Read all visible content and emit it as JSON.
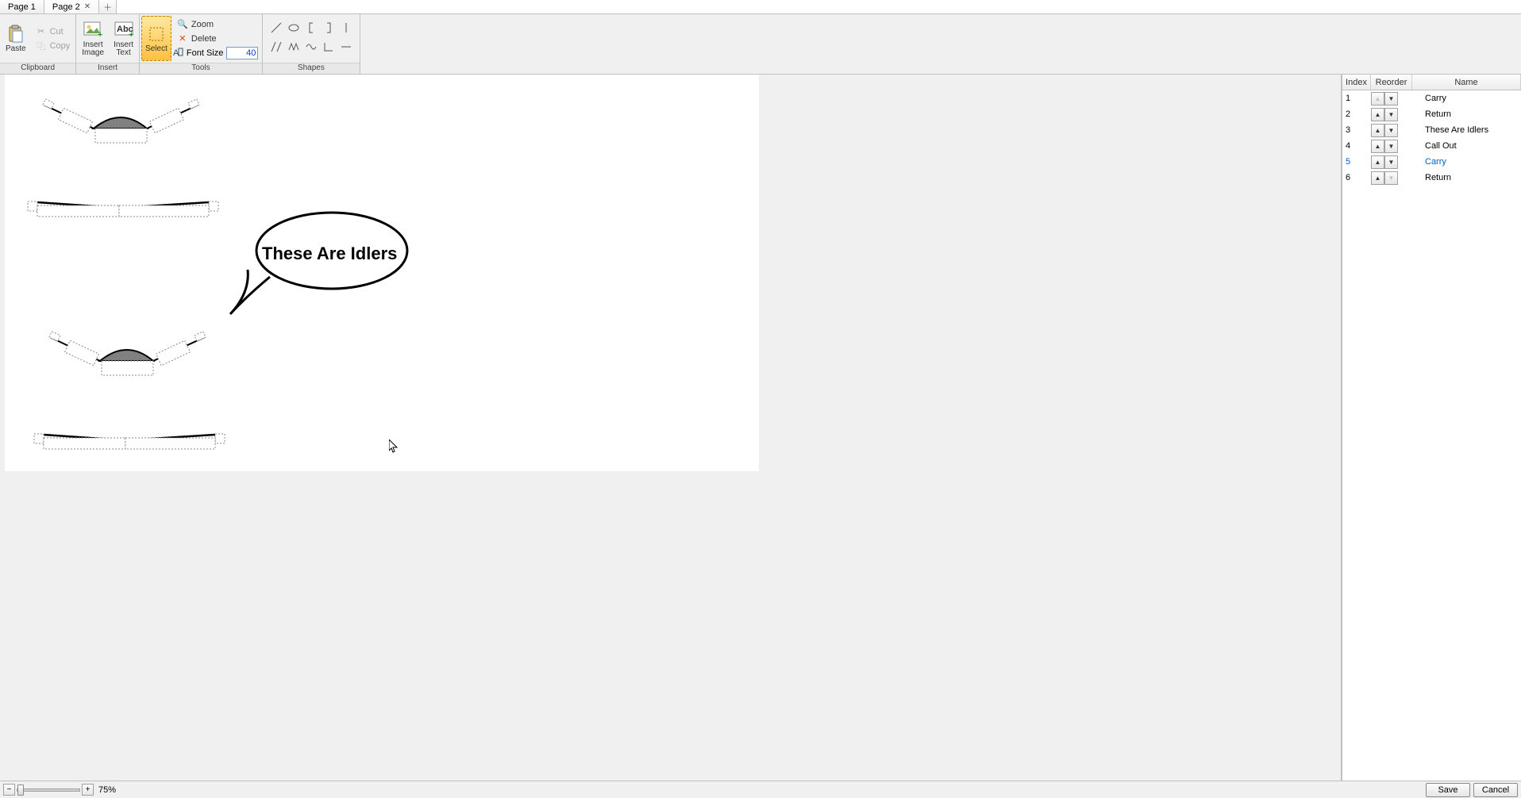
{
  "tabs": {
    "items": [
      {
        "label": "Page 1",
        "active": false
      },
      {
        "label": "Page 2",
        "active": true
      }
    ]
  },
  "ribbon": {
    "clipboard": {
      "label": "Clipboard",
      "paste": "Paste",
      "cut": "Cut",
      "copy": "Copy"
    },
    "insert": {
      "label": "Insert",
      "image": "Insert\nImage",
      "text": "Insert\nText"
    },
    "tools": {
      "label": "Tools",
      "select": "Select",
      "zoom": "Zoom",
      "delete": "Delete",
      "fontsize_label": "Font Size",
      "fontsize_value": "40"
    },
    "shapes": {
      "label": "Shapes",
      "shape_names": [
        "line",
        "ellipse",
        "bracket-left",
        "bracket-right",
        "vline",
        "dbl-line",
        "zigzag",
        "wave",
        "angle",
        "dash"
      ]
    }
  },
  "canvas": {
    "callout_text": "These Are Idlers"
  },
  "panel": {
    "headers": {
      "index": "Index",
      "reorder": "Reorder",
      "name": "Name"
    },
    "rows": [
      {
        "index": "1",
        "name": "Carry",
        "up_disabled": true,
        "down_disabled": false
      },
      {
        "index": "2",
        "name": "Return",
        "up_disabled": false,
        "down_disabled": false
      },
      {
        "index": "3",
        "name": "These Are Idlers",
        "up_disabled": false,
        "down_disabled": false
      },
      {
        "index": "4",
        "name": "Call Out",
        "up_disabled": false,
        "down_disabled": false
      },
      {
        "index": "5",
        "name": "Carry",
        "up_disabled": false,
        "down_disabled": false,
        "selected": true
      },
      {
        "index": "6",
        "name": "Return",
        "up_disabled": false,
        "down_disabled": true
      }
    ]
  },
  "bottom": {
    "zoom_pct": "75%",
    "save": "Save",
    "cancel": "Cancel"
  }
}
